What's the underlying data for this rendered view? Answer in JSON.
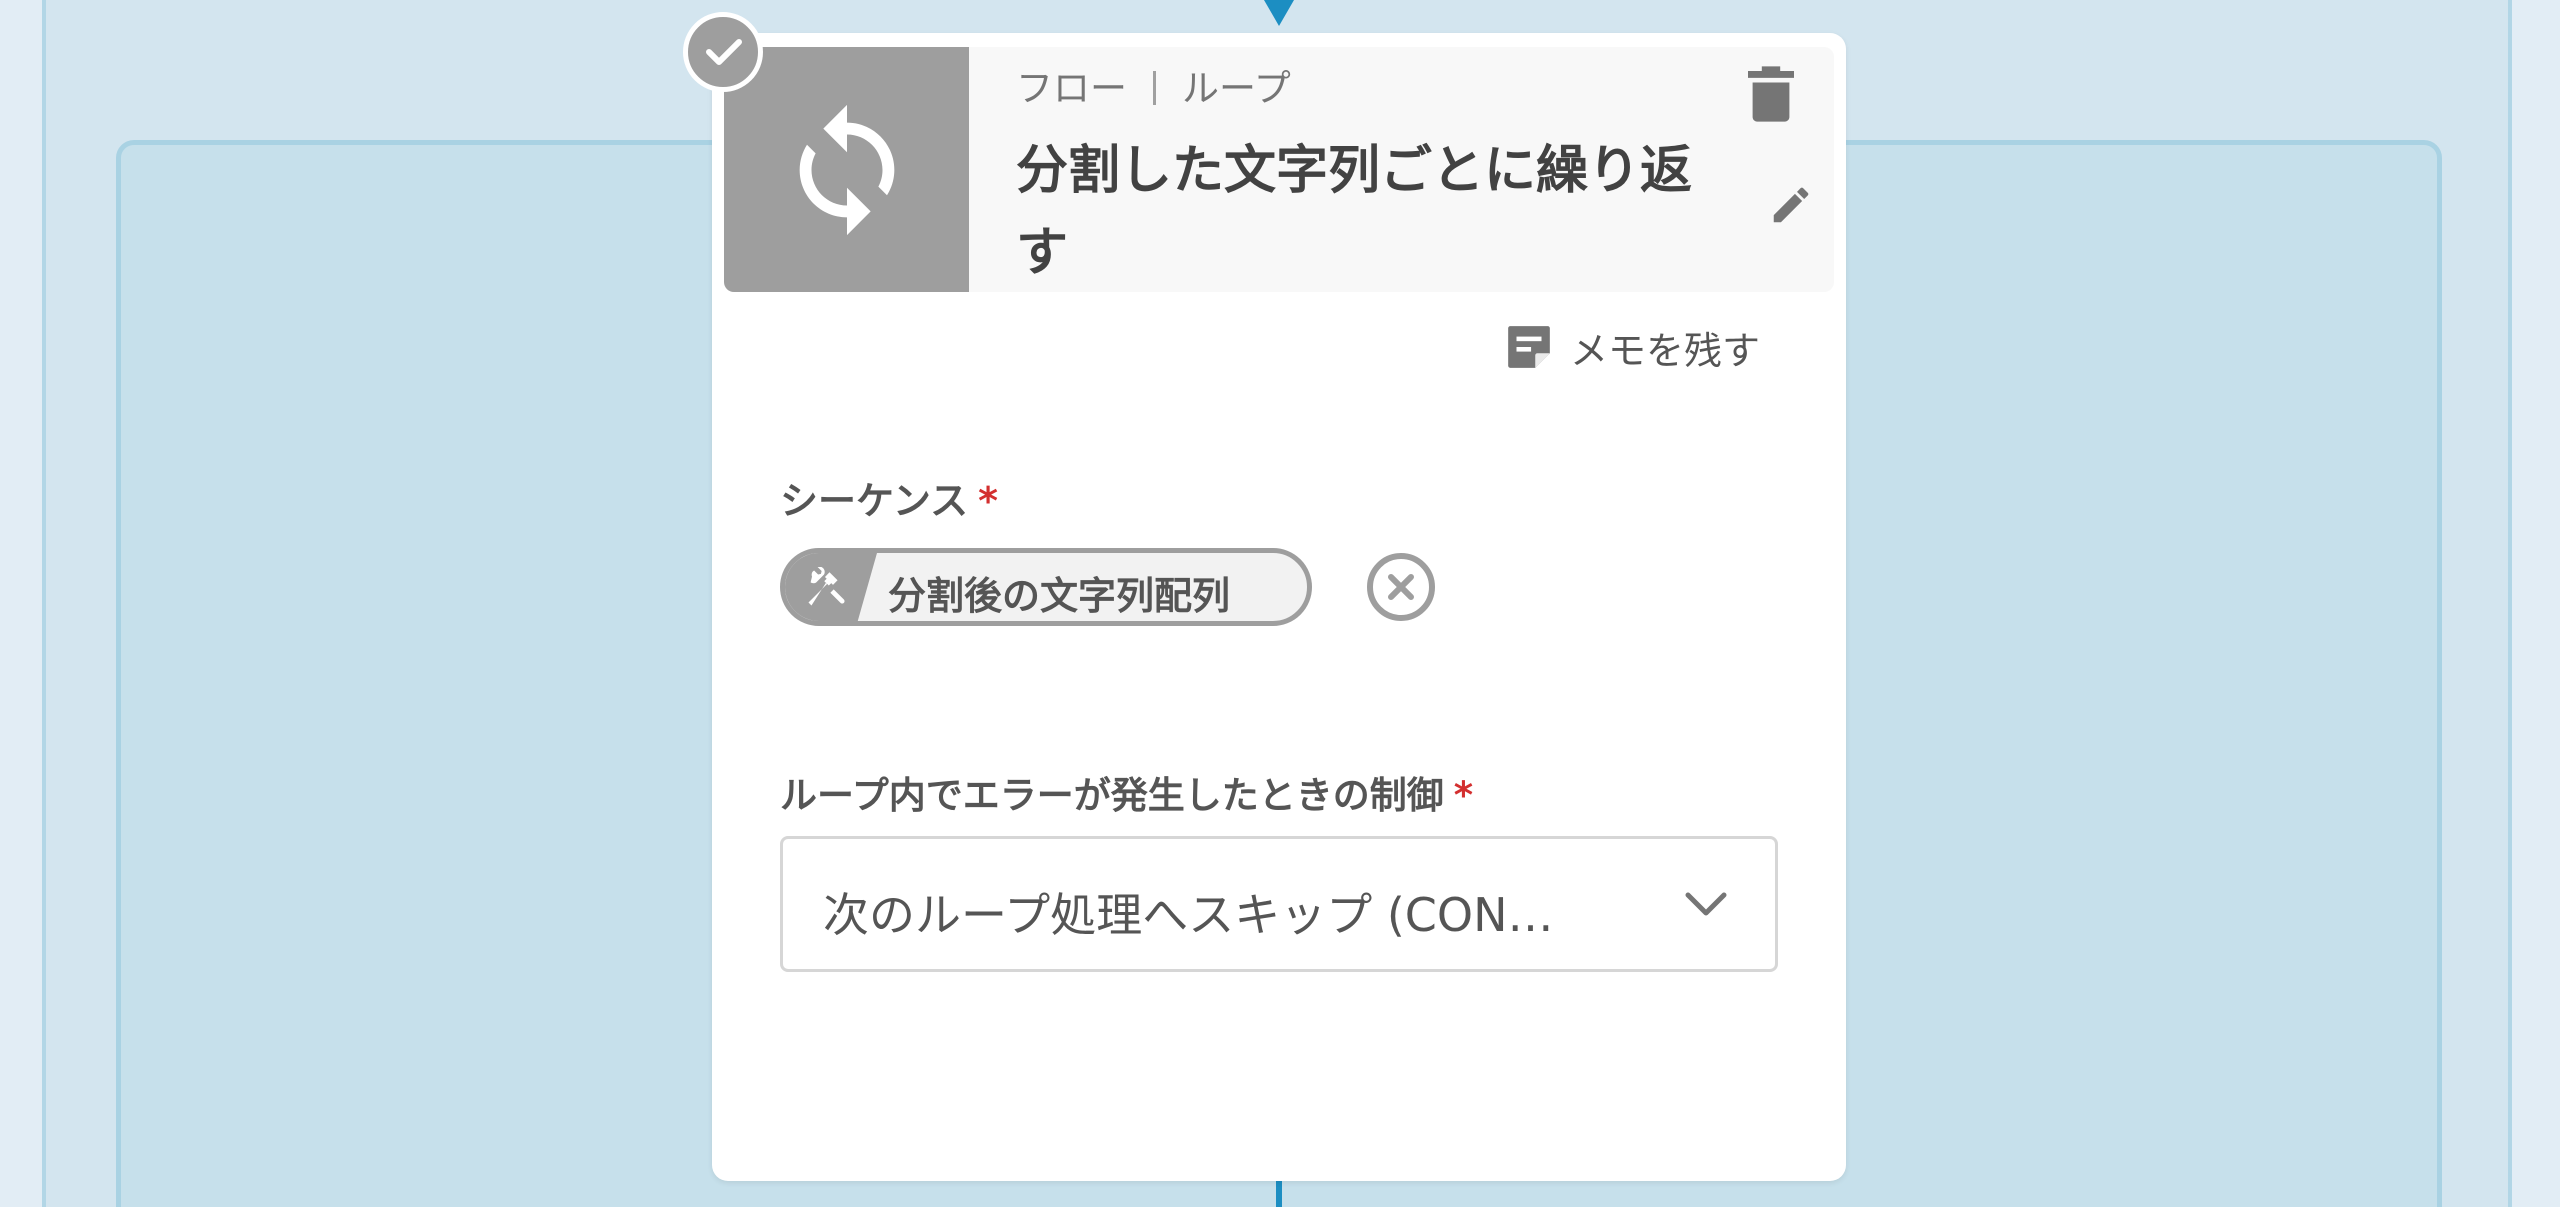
{
  "node": {
    "breadcrumb": {
      "category": "フロー",
      "type": "ループ"
    },
    "title": "分割した文字列ごとに繰り返す",
    "icon": "loop-sync-icon",
    "status_icon": "check-icon",
    "actions": {
      "delete_icon": "trash-icon",
      "edit_icon": "pencil-icon"
    },
    "memo": {
      "icon": "note-icon",
      "label": "メモを残す"
    }
  },
  "fields": {
    "sequence": {
      "label": "シーケンス",
      "required_mark": "*",
      "chip": {
        "icon": "tools-icon",
        "label": "分割後の文字列配列"
      },
      "remove_icon": "close-circle-icon"
    },
    "error_control": {
      "label": "ループ内でエラーが発生したときの制御",
      "required_mark": "*",
      "selected_value": "次のループ処理へスキップ (CON…"
    }
  },
  "colors": {
    "accent": "#1c8ec2",
    "node_gray": "#9e9e9e",
    "required": "#d32f2f",
    "canvas_outer": "#d3e5ef",
    "canvas_inner": "#c6e0eb"
  }
}
